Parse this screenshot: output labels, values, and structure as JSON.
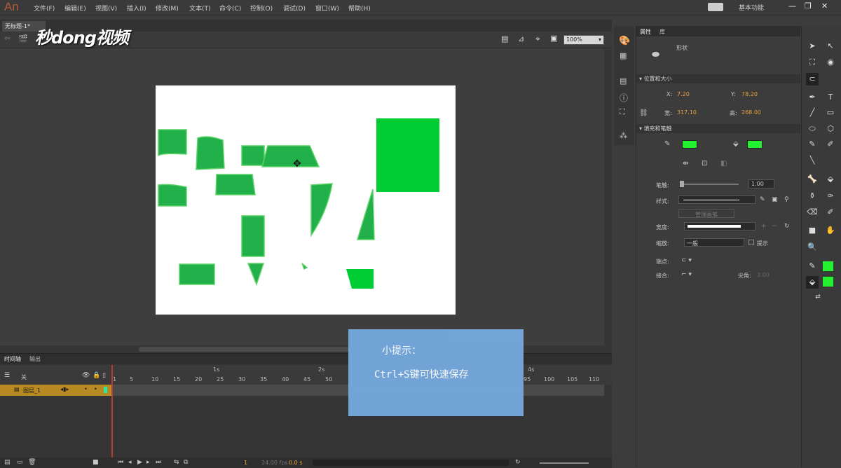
{
  "app": {
    "logo": "An"
  },
  "menu": [
    "文件(F)",
    "编辑(E)",
    "视图(V)",
    "插入(I)",
    "修改(M)",
    "文本(T)",
    "命令(C)",
    "控制(O)",
    "调试(D)",
    "窗口(W)",
    "帮助(H)"
  ],
  "workspace": {
    "label": "基本功能"
  },
  "document": {
    "tab": "无标题-1*"
  },
  "watermark": "秒dong视频",
  "editbar": {
    "zoom": "100%"
  },
  "timeline": {
    "tabs": [
      "时间轴",
      "输出"
    ],
    "layer_name": "图层_1",
    "layer_header": "关",
    "seconds": [
      "1s",
      "2s",
      "4s"
    ],
    "frames": [
      "1",
      "5",
      "10",
      "15",
      "20",
      "25",
      "30",
      "35",
      "40",
      "45",
      "50",
      "95",
      "100",
      "105",
      "110"
    ],
    "current_frame": "1",
    "fps": "24.00 fps",
    "elapsed": "0.0 s"
  },
  "hint": {
    "title": "小提示：",
    "body": "Ctrl+S键可快速保存"
  },
  "properties": {
    "tabs": [
      "属性",
      "库"
    ],
    "type": "形状",
    "position_section": "位置和大小",
    "x_label": "X:",
    "x": "7.20",
    "y_label": "Y:",
    "y": "78.20",
    "w_label": "宽:",
    "w": "317.10",
    "h_label": "高:",
    "h": "268.00",
    "fill_section": "填充和笔触",
    "stroke_label": "笔触:",
    "stroke": "1.00",
    "style_label": "样式:",
    "manage_brush": "管理画笔",
    "width_label": "宽度:",
    "scale_label": "缩放:",
    "scale": "一般",
    "hint_label": "提示",
    "cap_label": "端点:",
    "join_label": "接合:",
    "miter_label": "尖角:",
    "miter": "3.00",
    "fill_color": "#22f030",
    "stroke_color": "#22f030"
  },
  "colors": {
    "shape_green": "#22b04a",
    "bright_green": "#00cc33",
    "hint_bg": "#74a7dc",
    "layer_bg": "#b88a22"
  }
}
